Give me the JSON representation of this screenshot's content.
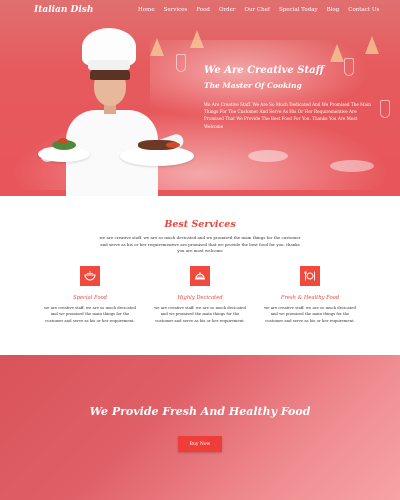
{
  "nav": {
    "logo": "Italian Dish",
    "items": [
      "Home",
      "Services",
      "Food",
      "Order",
      "Our Chef",
      "Special Today",
      "Blog",
      "Contact Us"
    ]
  },
  "hero": {
    "title": "We Are Creative Staff",
    "subtitle": "The Master Of Cooking",
    "text": "We Are Creative Staff. We Are So Much Dedicated And We Promised The Main Things For The Customer And Serve As His Or Her Requirementwe Are Promised That We Provide The Best Food For You. Thanks You Are Most Welcome"
  },
  "services": {
    "title": "Best Services",
    "intro": "we are creative staff. we are so much decicated and we promised the main things for the customer and serve as his or her requirementwe are promised that we provide the best food for you. thanks you are most welcome",
    "items": [
      {
        "icon": "bowl-icon",
        "title": "Special Food",
        "text": "we are creative staff. we are so much decicated and we promised the main things for the customer and serve as his or her requirement."
      },
      {
        "icon": "serving-cloche-icon",
        "title": "Highly Decicated",
        "text": "we are creative staff. we are so much decicated and we promised the main things for the customer and serve as his or her requirement."
      },
      {
        "icon": "cutlery-icon",
        "title": "Fresh & Healthy Food",
        "text": "we are creative staff. we are so much decicated and we promised the main things for the customer and serve as his or her requirement."
      }
    ]
  },
  "cta": {
    "title": "We Provide Fresh And Healthy Food",
    "button": "Buy Now"
  },
  "colors": {
    "accent": "#ef4a3d",
    "hero_bg": "#e65a5d",
    "cta_bg_start": "#d9535a",
    "cta_bg_end": "#f7a3a3"
  }
}
